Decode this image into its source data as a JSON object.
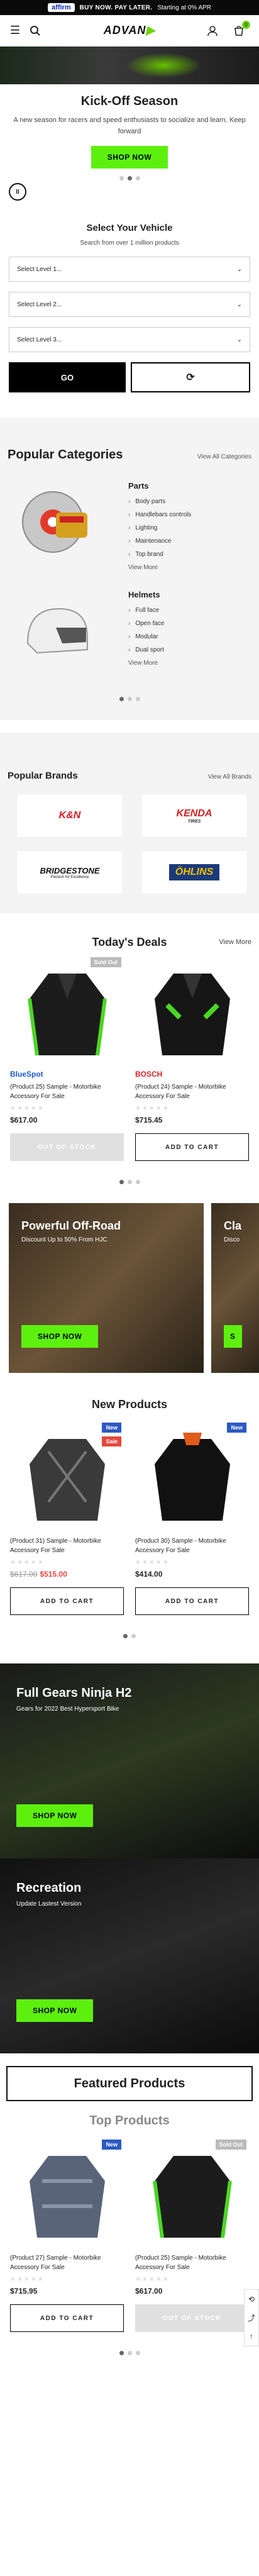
{
  "promo": {
    "brand": "affirm",
    "text": "BUY NOW. PAY LATER.",
    "sub": "Starting at 0% APR"
  },
  "header": {
    "logo_main": "ADVAN",
    "logo_accent": "",
    "cart_count": "0"
  },
  "hero": {
    "title": "Kick-Off Season",
    "text": "A new season for racers and speed enthusiasts to socialize and learn. Keep forward",
    "button": "SHOP NOW",
    "pause": "II"
  },
  "vehicle": {
    "title": "Select Your Vehicle",
    "subtitle": "Search from over 1 million products",
    "level1": "Select Level 1...",
    "level2": "Select Level 2...",
    "level3": "Select Level 3...",
    "go": "GO",
    "reset": "⟳"
  },
  "categories": {
    "title": "Popular Categories",
    "view_all": "View All Categories",
    "items": [
      {
        "name": "Parts",
        "subs": [
          "Body parts",
          "Handlebars controls",
          "Lighting",
          "Maintenance",
          "Top brand"
        ],
        "more": "View More"
      },
      {
        "name": "Helmets",
        "subs": [
          "Full face",
          "Open face",
          "Modular",
          "Dual sport"
        ],
        "more": "View More"
      }
    ]
  },
  "brands": {
    "title": "Popular Brands",
    "view_all": "View All Brands",
    "logos": [
      "K&N",
      "KENDA",
      "BRIDGESTONE",
      "ÖHLINS"
    ],
    "kenda_sub": "TIRES",
    "bridgestone_sub": "Passion for Excellence"
  },
  "deals": {
    "title": "Today's Deals",
    "view_more": "View More",
    "products": [
      {
        "tag": "Sold Out",
        "brand": "BlueSpot",
        "name": "(Product 25) Sample - Motorbike Accessory For Sale",
        "stars": "★★★★★",
        "price": "$617.00",
        "button": "OUT OF STOCK"
      },
      {
        "tag": "",
        "brand": "BOSCH",
        "name": "(Product 24) Sample - Motorbike Accessory For Sale",
        "stars": "★★★★★",
        "price": "$715.45",
        "button": "ADD TO CART"
      }
    ]
  },
  "banners": [
    {
      "title": "Powerful Off-Road",
      "sub": "Discount Up to 50% From HJC",
      "button": "SHOP NOW"
    },
    {
      "title": "Cla",
      "sub": "Disco",
      "button": "S"
    }
  ],
  "new_products": {
    "title": "New Products",
    "products": [
      {
        "tag": "New",
        "tag2": "Sale",
        "name": "(Product 31) Sample - Motorbike Accessory For Sale",
        "stars": "★★★★★",
        "old_price": "$617.00",
        "price": "$515.00",
        "button": "ADD TO CART"
      },
      {
        "tag": "New",
        "tag2": "",
        "name": "(Product 30) Sample - Motorbike Accessory For Sale",
        "stars": "★★★★★",
        "old_price": "",
        "price": "$414.00",
        "button": "ADD TO CART"
      }
    ]
  },
  "big_banners": [
    {
      "title": "Full Gears Ninja H2",
      "sub": "Gears for 2022 Best Hypersport Bike",
      "button": "SHOP NOW"
    },
    {
      "title": "Recreation",
      "sub": "Update Lastest Version",
      "button": "SHOP NOW"
    }
  ],
  "featured": {
    "title": "Featured Products"
  },
  "top_products": {
    "title": "Top Products",
    "products": [
      {
        "tag": "New",
        "name": "(Product 27) Sample - Motorbike Accessory For Sale",
        "stars": "★★★★★",
        "price": "$715.95",
        "button": "ADD TO CART"
      },
      {
        "tag": "Sold Out",
        "name": "(Product 25) Sample - Motorbike Accessory For Sale",
        "stars": "★★★★★",
        "price": "$617.00",
        "button": "OUT OF STOCK"
      }
    ]
  },
  "colors": {
    "accent": "#5df00f",
    "sale": "#e5483b",
    "new": "#2b59c3"
  }
}
